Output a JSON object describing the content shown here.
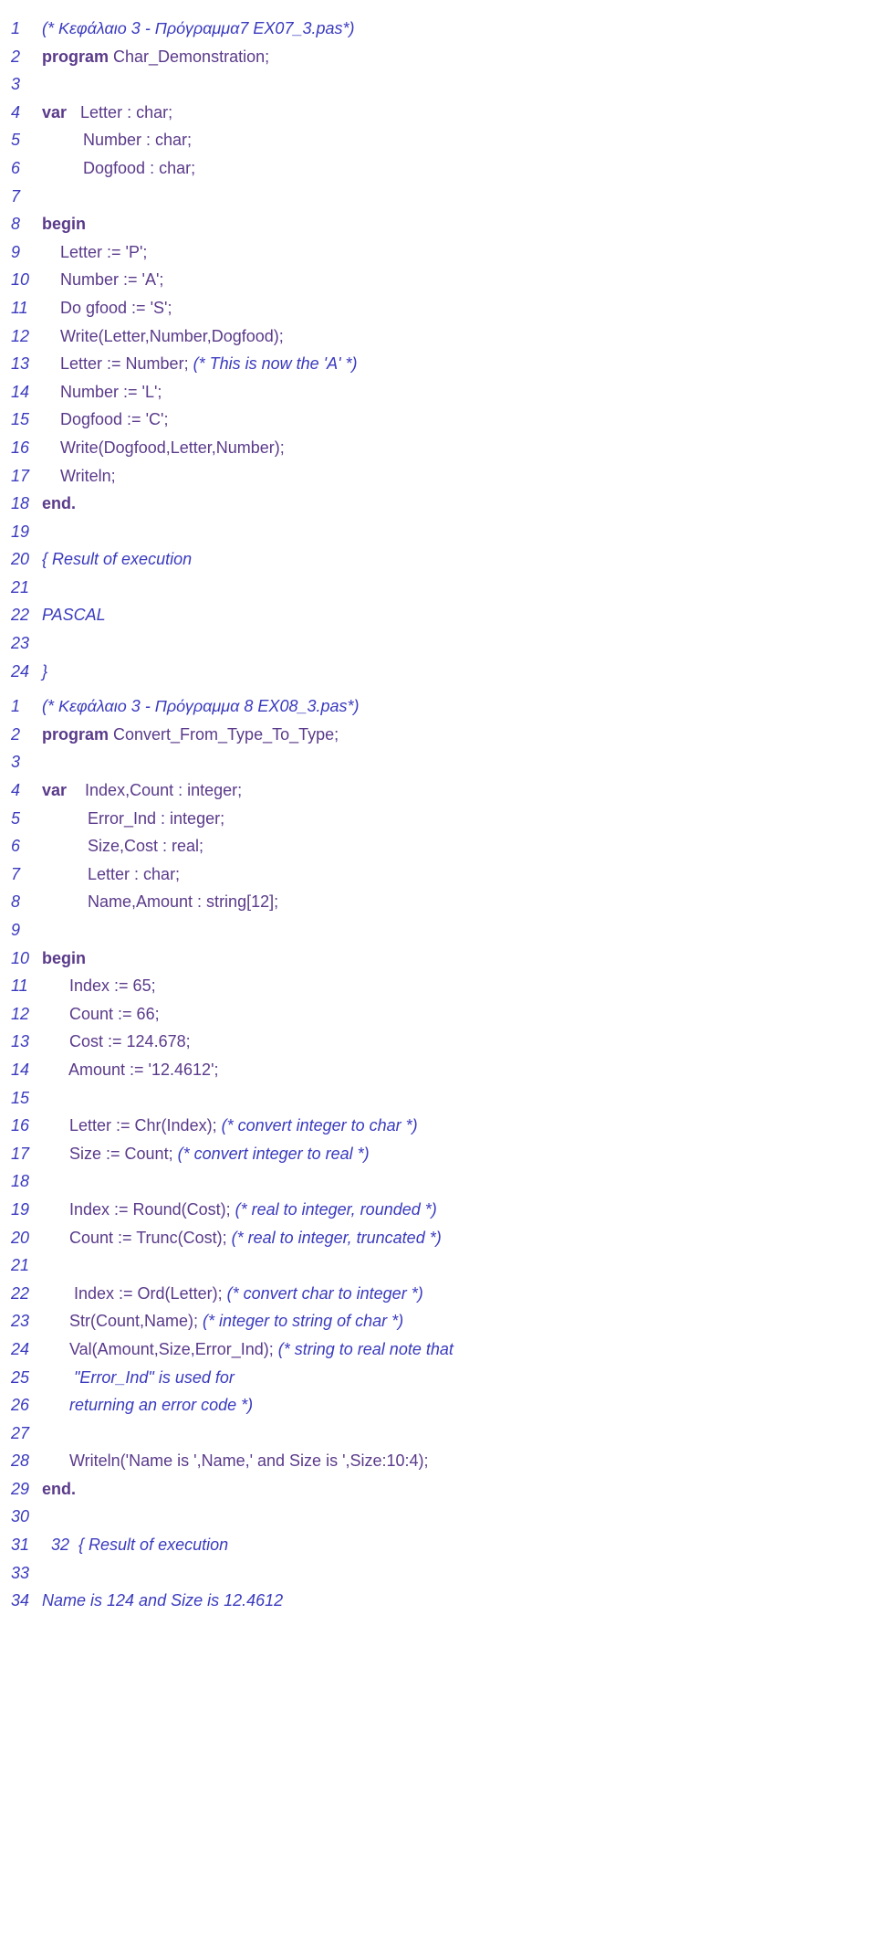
{
  "block1": {
    "lines": [
      {
        "n": "1",
        "segs": [
          {
            "cls": "comment",
            "t": "(* Κεφάλαιο 3 - Πρόγραμμα7 EX07_3.pas*)"
          }
        ]
      },
      {
        "n": "2",
        "segs": [
          {
            "cls": "keyword",
            "t": "program"
          },
          {
            "cls": "code",
            "t": " Char_Demonstration;"
          }
        ]
      },
      {
        "n": "3",
        "segs": []
      },
      {
        "n": "4",
        "segs": [
          {
            "cls": "keyword",
            "t": "var"
          },
          {
            "cls": "code",
            "t": "   Letter : char;"
          }
        ]
      },
      {
        "n": "5",
        "segs": [
          {
            "cls": "code",
            "t": "         Number : char;"
          }
        ]
      },
      {
        "n": "6",
        "segs": [
          {
            "cls": "code",
            "t": "         Dogfood : char;"
          }
        ]
      },
      {
        "n": "7",
        "segs": []
      },
      {
        "n": "8",
        "segs": [
          {
            "cls": "keyword",
            "t": "begin"
          }
        ]
      },
      {
        "n": "9",
        "segs": [
          {
            "cls": "code",
            "t": "    Letter := 'P';"
          }
        ]
      },
      {
        "n": "10",
        "segs": [
          {
            "cls": "code",
            "t": "    Number := 'A';"
          }
        ]
      },
      {
        "n": "11",
        "segs": [
          {
            "cls": "code",
            "t": "    Do gfood := 'S';"
          }
        ]
      },
      {
        "n": "12",
        "segs": [
          {
            "cls": "code",
            "t": "    Write(Letter,Number,Dogfood);"
          }
        ]
      },
      {
        "n": "13",
        "segs": [
          {
            "cls": "code",
            "t": "    Letter := Number; "
          },
          {
            "cls": "comment",
            "t": "(* This is now the 'A' *)"
          }
        ]
      },
      {
        "n": "14",
        "segs": [
          {
            "cls": "code",
            "t": "    Number := 'L';"
          }
        ]
      },
      {
        "n": "15",
        "segs": [
          {
            "cls": "code",
            "t": "    Dogfood := 'C';"
          }
        ]
      },
      {
        "n": "16",
        "segs": [
          {
            "cls": "code",
            "t": "    Write(Dogfood,Letter,Number);"
          }
        ]
      },
      {
        "n": "17",
        "segs": [
          {
            "cls": "code",
            "t": "    Writeln;"
          }
        ]
      },
      {
        "n": "18",
        "segs": [
          {
            "cls": "keyword",
            "t": "end."
          }
        ]
      },
      {
        "n": "19",
        "segs": []
      },
      {
        "n": "20",
        "segs": [
          {
            "cls": "comment",
            "t": "{ Result of execution"
          }
        ]
      },
      {
        "n": "21",
        "segs": []
      },
      {
        "n": "22",
        "segs": [
          {
            "cls": "comment",
            "t": "PASCAL"
          }
        ]
      },
      {
        "n": "23",
        "segs": []
      },
      {
        "n": "24",
        "segs": [
          {
            "cls": "comment",
            "t": "}"
          }
        ]
      }
    ]
  },
  "block2": {
    "lines": [
      {
        "n": "1",
        "segs": [
          {
            "cls": "comment",
            "t": "(* Κεφάλαιο 3 - Πρόγραμμα 8 EX08_3.pas*)"
          }
        ]
      },
      {
        "n": "2",
        "segs": [
          {
            "cls": "keyword",
            "t": "program"
          },
          {
            "cls": "code",
            "t": " Convert_From_Type_To_Type;"
          }
        ]
      },
      {
        "n": "3",
        "segs": []
      },
      {
        "n": "4",
        "segs": [
          {
            "cls": "keyword",
            "t": "var"
          },
          {
            "cls": "code",
            "t": "    Index,Count : integer;"
          }
        ]
      },
      {
        "n": "5",
        "segs": [
          {
            "cls": "code",
            "t": "          Error_Ind : integer;"
          }
        ]
      },
      {
        "n": "6",
        "segs": [
          {
            "cls": "code",
            "t": "          Size,Cost : real;"
          }
        ]
      },
      {
        "n": "7",
        "segs": [
          {
            "cls": "code",
            "t": "          Letter : char;"
          }
        ]
      },
      {
        "n": "8",
        "segs": [
          {
            "cls": "code",
            "t": "          Name,Amount : string[12];"
          }
        ]
      },
      {
        "n": "9",
        "segs": []
      },
      {
        "n": "10",
        "segs": [
          {
            "cls": "keyword",
            "t": "begin"
          }
        ]
      },
      {
        "n": "11",
        "segs": [
          {
            "cls": "code",
            "t": "      Index := 65;"
          }
        ]
      },
      {
        "n": "12",
        "segs": [
          {
            "cls": "code",
            "t": "      Count := 66;"
          }
        ]
      },
      {
        "n": "13",
        "segs": [
          {
            "cls": "code",
            "t": "      Cost := 124.678;"
          }
        ]
      },
      {
        "n": "14",
        "segs": [
          {
            "cls": "code",
            "t": "      Amount := '12.4612';"
          }
        ]
      },
      {
        "n": "15",
        "segs": []
      },
      {
        "n": "16",
        "segs": [
          {
            "cls": "code",
            "t": "      Letter := Chr(Index); "
          },
          {
            "cls": "comment",
            "t": "(* convert integer to char *)"
          }
        ]
      },
      {
        "n": "17",
        "segs": [
          {
            "cls": "code",
            "t": "      Size := Count; "
          },
          {
            "cls": "comment",
            "t": "(* convert integer to real *)"
          }
        ]
      },
      {
        "n": "18",
        "segs": []
      },
      {
        "n": "19",
        "segs": [
          {
            "cls": "code",
            "t": "      Index := Round(Cost); "
          },
          {
            "cls": "comment",
            "t": "(* real to integer, rounded *)"
          }
        ]
      },
      {
        "n": "20",
        "segs": [
          {
            "cls": "code",
            "t": "      Count := Trunc(Cost); "
          },
          {
            "cls": "comment",
            "t": "(* real to integer, truncated *)"
          }
        ]
      },
      {
        "n": "21",
        "segs": []
      },
      {
        "n": "22",
        "segs": [
          {
            "cls": "code",
            "t": "       Index := Ord(Letter); "
          },
          {
            "cls": "comment",
            "t": "(* convert char to integer *)"
          }
        ]
      },
      {
        "n": "23",
        "segs": [
          {
            "cls": "code",
            "t": "      Str(Count,Name); "
          },
          {
            "cls": "comment",
            "t": "(* integer to string of char *)"
          }
        ]
      },
      {
        "n": "24",
        "segs": [
          {
            "cls": "code",
            "t": "      Val(Amount,Size,Error_Ind); "
          },
          {
            "cls": "comment",
            "t": "(* string to real note that"
          }
        ]
      },
      {
        "n": "25",
        "segs": [
          {
            "cls": "comment",
            "t": "       \"Error_Ind\" is used for"
          }
        ]
      },
      {
        "n": "26",
        "segs": [
          {
            "cls": "comment",
            "t": "      returning an error code *)"
          }
        ]
      },
      {
        "n": "27",
        "segs": []
      },
      {
        "n": "28",
        "segs": [
          {
            "cls": "code",
            "t": "      Writeln('Name is ',Name,' and Size is ',Size:10:4);"
          }
        ]
      },
      {
        "n": "29",
        "segs": [
          {
            "cls": "keyword",
            "t": "end."
          }
        ]
      },
      {
        "n": "30",
        "segs": []
      },
      {
        "n": "31",
        "segs": [
          {
            "cls": "comment",
            "t": "  32  { Result of execution"
          }
        ]
      },
      {
        "n": "33",
        "segs": []
      },
      {
        "n": "34",
        "segs": [
          {
            "cls": "comment",
            "t": "Name is 124 and Size is 12.4612"
          }
        ]
      }
    ]
  }
}
